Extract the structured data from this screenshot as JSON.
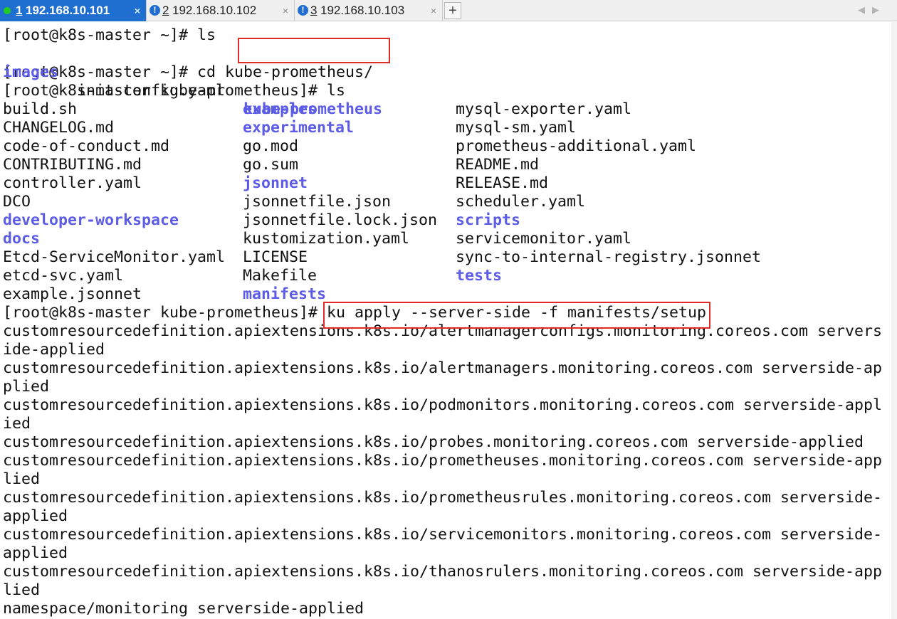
{
  "tabs": [
    {
      "number": "1",
      "label": "192.168.10.101",
      "active": true
    },
    {
      "number": "2",
      "label": "192.168.10.102",
      "active": false
    },
    {
      "number": "3",
      "label": "192.168.10.103",
      "active": false
    }
  ],
  "tab_controls": {
    "close": "×",
    "new_tab": "+",
    "prev": "◀",
    "next": "▶"
  },
  "terminal": {
    "line1": "[root@k8s-master ~]# ls",
    "ls1": {
      "c1": "images",
      "c2": "init-config.yaml",
      "c3": "kube-prometheus"
    },
    "line3": "[root@k8s-master ~]# cd kube-prometheus/",
    "line4": "[root@k8s-master kube-prometheus]# ls",
    "listing": {
      "col1": [
        "build.sh",
        "CHANGELOG.md",
        "code-of-conduct.md",
        "CONTRIBUTING.md",
        "controller.yaml",
        "DCO",
        "developer-workspace",
        "docs",
        "Etcd-ServiceMonitor.yaml",
        "etcd-svc.yaml",
        "example.jsonnet"
      ],
      "col2": [
        "examples",
        "experimental",
        "go.mod",
        "go.sum",
        "jsonnet",
        "jsonnetfile.json",
        "jsonnetfile.lock.json",
        "kustomization.yaml",
        "LICENSE",
        "Makefile",
        "manifests"
      ],
      "col3": [
        "mysql-exporter.yaml",
        "mysql-sm.yaml",
        "prometheus-additional.yaml",
        "README.md",
        "RELEASE.md",
        "scheduler.yaml",
        "scripts",
        "servicemonitor.yaml",
        "sync-to-internal-registry.jsonnet",
        "tests"
      ]
    },
    "prompt2": "[root@k8s-master kube-prometheus]# ",
    "command2": "ku apply --server-side -f manifests/setup",
    "output": [
      "customresourcedefinition.apiextensions.k8s.io/alertmanagerconfigs.monitoring.coreos.com servers",
      "ide-applied",
      "customresourcedefinition.apiextensions.k8s.io/alertmanagers.monitoring.coreos.com serverside-ap",
      "plied",
      "customresourcedefinition.apiextensions.k8s.io/podmonitors.monitoring.coreos.com serverside-appl",
      "ied",
      "customresourcedefinition.apiextensions.k8s.io/probes.monitoring.coreos.com serverside-applied",
      "customresourcedefinition.apiextensions.k8s.io/prometheuses.monitoring.coreos.com serverside-app",
      "lied",
      "customresourcedefinition.apiextensions.k8s.io/prometheusrules.monitoring.coreos.com serverside-",
      "applied",
      "customresourcedefinition.apiextensions.k8s.io/servicemonitors.monitoring.coreos.com serverside-",
      "applied",
      "customresourcedefinition.apiextensions.k8s.io/thanosrulers.monitoring.coreos.com serverside-app",
      "lied",
      "namespace/monitoring serverside-applied"
    ]
  },
  "colors": {
    "directory": "#5c5ce6",
    "highlight_box": "#e02b2b",
    "active_tab": "#1f6fd1"
  }
}
